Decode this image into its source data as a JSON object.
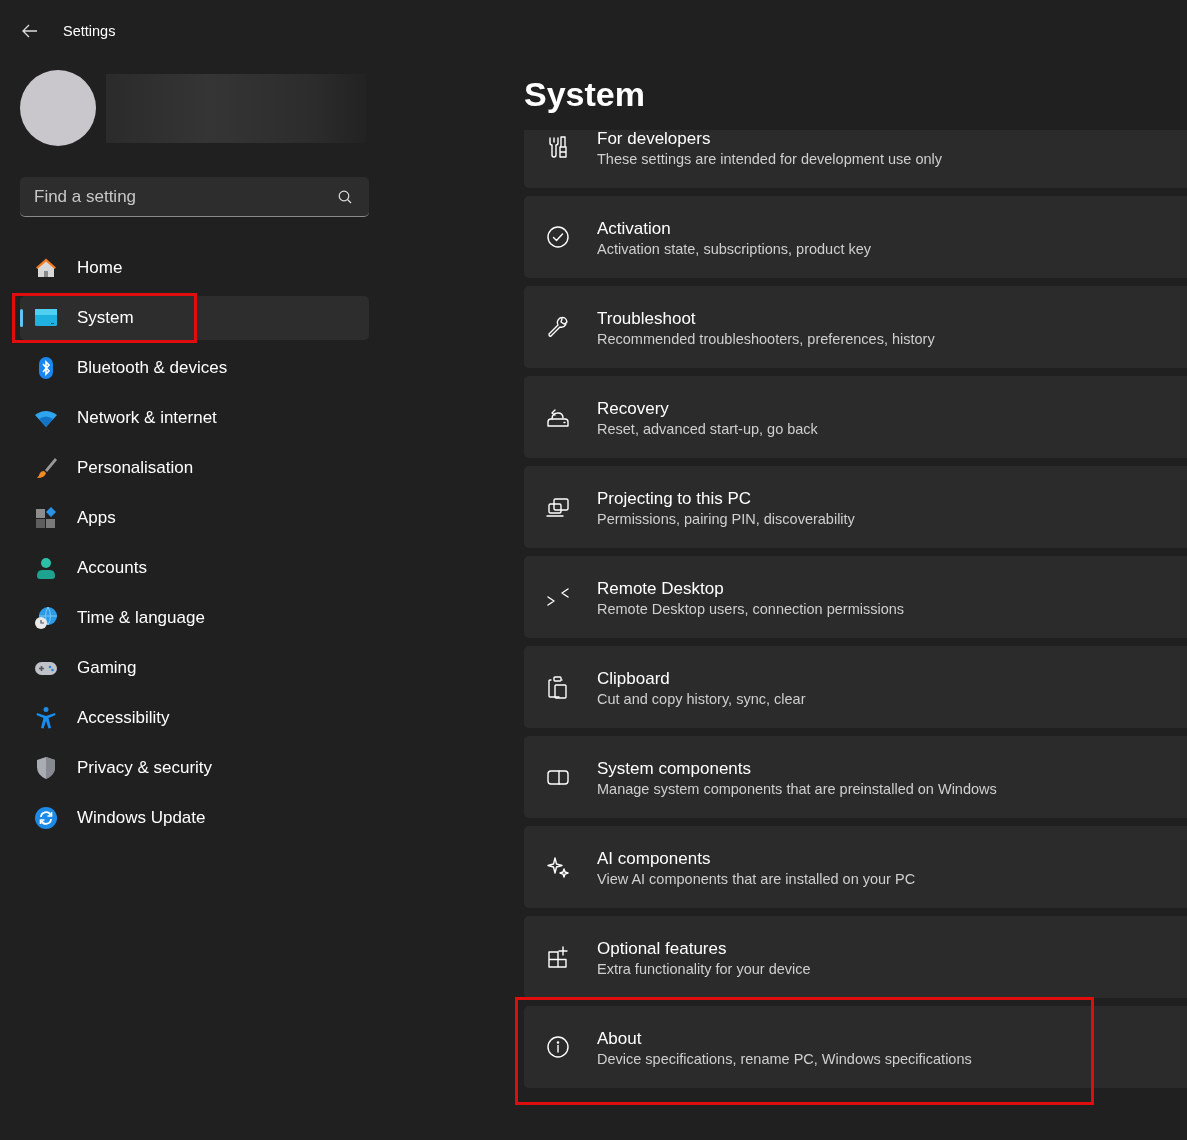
{
  "window": {
    "title": "Settings"
  },
  "sidebar": {
    "search": {
      "placeholder": "Find a setting"
    },
    "items": [
      {
        "label": "Home",
        "selected": false,
        "highlighted": false
      },
      {
        "label": "System",
        "selected": true,
        "highlighted": true
      },
      {
        "label": "Bluetooth & devices",
        "selected": false,
        "highlighted": false
      },
      {
        "label": "Network & internet",
        "selected": false,
        "highlighted": false
      },
      {
        "label": "Personalisation",
        "selected": false,
        "highlighted": false
      },
      {
        "label": "Apps",
        "selected": false,
        "highlighted": false
      },
      {
        "label": "Accounts",
        "selected": false,
        "highlighted": false
      },
      {
        "label": "Time & language",
        "selected": false,
        "highlighted": false
      },
      {
        "label": "Gaming",
        "selected": false,
        "highlighted": false
      },
      {
        "label": "Accessibility",
        "selected": false,
        "highlighted": false
      },
      {
        "label": "Privacy & security",
        "selected": false,
        "highlighted": false
      },
      {
        "label": "Windows Update",
        "selected": false,
        "highlighted": false
      }
    ]
  },
  "page": {
    "title": "System",
    "cards": [
      {
        "title": "For developers",
        "subtitle": "These settings are intended for development use only",
        "highlighted": false
      },
      {
        "title": "Activation",
        "subtitle": "Activation state, subscriptions, product key",
        "highlighted": false
      },
      {
        "title": "Troubleshoot",
        "subtitle": "Recommended troubleshooters, preferences, history",
        "highlighted": false
      },
      {
        "title": "Recovery",
        "subtitle": "Reset, advanced start-up, go back",
        "highlighted": false
      },
      {
        "title": "Projecting to this PC",
        "subtitle": "Permissions, pairing PIN, discoverability",
        "highlighted": false
      },
      {
        "title": "Remote Desktop",
        "subtitle": "Remote Desktop users, connection permissions",
        "highlighted": false
      },
      {
        "title": "Clipboard",
        "subtitle": "Cut and copy history, sync, clear",
        "highlighted": false
      },
      {
        "title": "System components",
        "subtitle": "Manage system components that are preinstalled on Windows",
        "highlighted": false
      },
      {
        "title": "AI components",
        "subtitle": "View AI components that are installed on your PC",
        "highlighted": false
      },
      {
        "title": "Optional features",
        "subtitle": "Extra functionality for your device",
        "highlighted": false
      },
      {
        "title": "About",
        "subtitle": "Device specifications, rename PC, Windows specifications",
        "highlighted": true
      }
    ]
  }
}
